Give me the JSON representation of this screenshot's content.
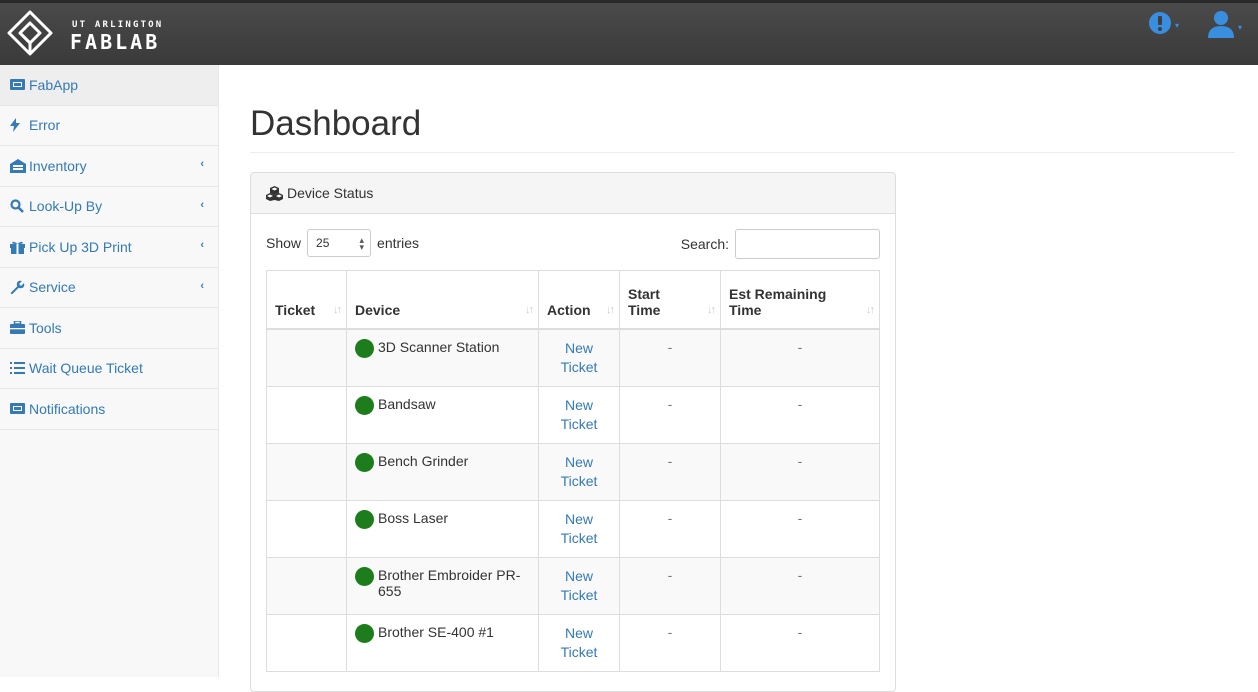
{
  "brand": {
    "line1": "UT ARLINGTON",
    "line2": "FABLAB"
  },
  "colors": {
    "accent": "#337ab7",
    "status_ok": "#1d7d1d",
    "navbar": "#3f3f3f"
  },
  "navbar": {
    "alert_icon": "exclamation-circle-icon",
    "user_icon": "user-icon"
  },
  "sidebar": {
    "items": [
      {
        "label": "FabApp",
        "icon": "ticket-icon",
        "submenu": false
      },
      {
        "label": "Error",
        "icon": "bolt-icon",
        "submenu": false
      },
      {
        "label": "Inventory",
        "icon": "warehouse-icon",
        "submenu": true
      },
      {
        "label": "Look-Up By",
        "icon": "search-icon",
        "submenu": true
      },
      {
        "label": "Pick Up 3D Print",
        "icon": "gift-icon",
        "submenu": true
      },
      {
        "label": "Service",
        "icon": "wrench-icon",
        "submenu": true
      },
      {
        "label": "Tools",
        "icon": "toolbox-icon",
        "submenu": false
      },
      {
        "label": "Wait Queue Ticket",
        "icon": "list-icon",
        "submenu": false
      },
      {
        "label": "Notifications",
        "icon": "ticket-icon",
        "submenu": false
      }
    ]
  },
  "main": {
    "title": "Dashboard",
    "panel": {
      "title": "Device Status",
      "show_label": "Show",
      "entries_value": "25",
      "entries_label": "entries",
      "search_label": "Search:",
      "search_value": "",
      "columns": [
        "Ticket",
        "Device",
        "Action",
        "Start Time",
        "Est Remaining Time"
      ],
      "rows": [
        {
          "ticket": "",
          "device": "3D Scanner Station",
          "action": "New Ticket",
          "start": "-",
          "remaining": "-"
        },
        {
          "ticket": "",
          "device": "Bandsaw",
          "action": "New Ticket",
          "start": "-",
          "remaining": "-"
        },
        {
          "ticket": "",
          "device": "Bench Grinder",
          "action": "New Ticket",
          "start": "-",
          "remaining": "-"
        },
        {
          "ticket": "",
          "device": "Boss Laser",
          "action": "New Ticket",
          "start": "-",
          "remaining": "-"
        },
        {
          "ticket": "",
          "device": "Brother Embroider PR-655",
          "action": "New Ticket",
          "start": "-",
          "remaining": "-"
        },
        {
          "ticket": "",
          "device": "Brother SE-400 #1",
          "action": "New Ticket",
          "start": "-",
          "remaining": "-"
        }
      ]
    }
  }
}
